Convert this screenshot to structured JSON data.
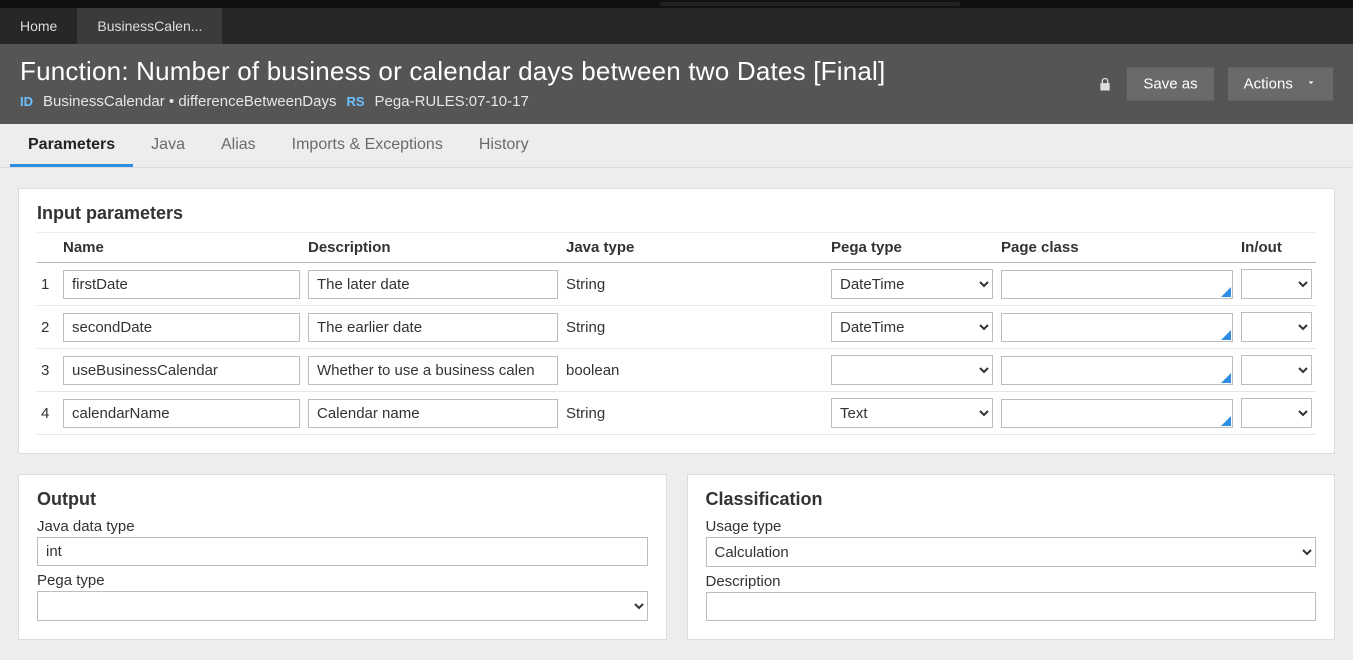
{
  "apptabs": {
    "home": "Home",
    "current": "BusinessCalen..."
  },
  "header": {
    "title": "Function: Number of business or calendar days between two Dates [Final]",
    "idLabel": "ID",
    "idValue": "BusinessCalendar • differenceBetweenDays",
    "rsLabel": "RS",
    "rsValue": "Pega-RULES:07-10-17",
    "saveAs": "Save as",
    "actions": "Actions"
  },
  "tabs": {
    "parameters": "Parameters",
    "java": "Java",
    "alias": "Alias",
    "imports": "Imports & Exceptions",
    "history": "History"
  },
  "inputParams": {
    "title": "Input parameters",
    "cols": {
      "name": "Name",
      "desc": "Description",
      "java": "Java type",
      "pega": "Pega type",
      "page": "Page class",
      "io": "In/out"
    },
    "rows": [
      {
        "idx": "1",
        "name": "firstDate",
        "desc": "The later date",
        "java": "String",
        "pega": "DateTime",
        "page": "",
        "io": ""
      },
      {
        "idx": "2",
        "name": "secondDate",
        "desc": "The earlier date",
        "java": "String",
        "pega": "DateTime",
        "page": "",
        "io": ""
      },
      {
        "idx": "3",
        "name": "useBusinessCalendar",
        "desc": "Whether to use a business calen",
        "java": "boolean",
        "pega": "",
        "page": "",
        "io": ""
      },
      {
        "idx": "4",
        "name": "calendarName",
        "desc": "Calendar name",
        "java": "String",
        "pega": "Text",
        "page": "",
        "io": ""
      }
    ]
  },
  "output": {
    "title": "Output",
    "javaLabel": "Java data type",
    "javaValue": "int",
    "pegaLabel": "Pega type",
    "pegaValue": ""
  },
  "classification": {
    "title": "Classification",
    "usageLabel": "Usage type",
    "usageValue": "Calculation",
    "descLabel": "Description",
    "descValue": ""
  }
}
